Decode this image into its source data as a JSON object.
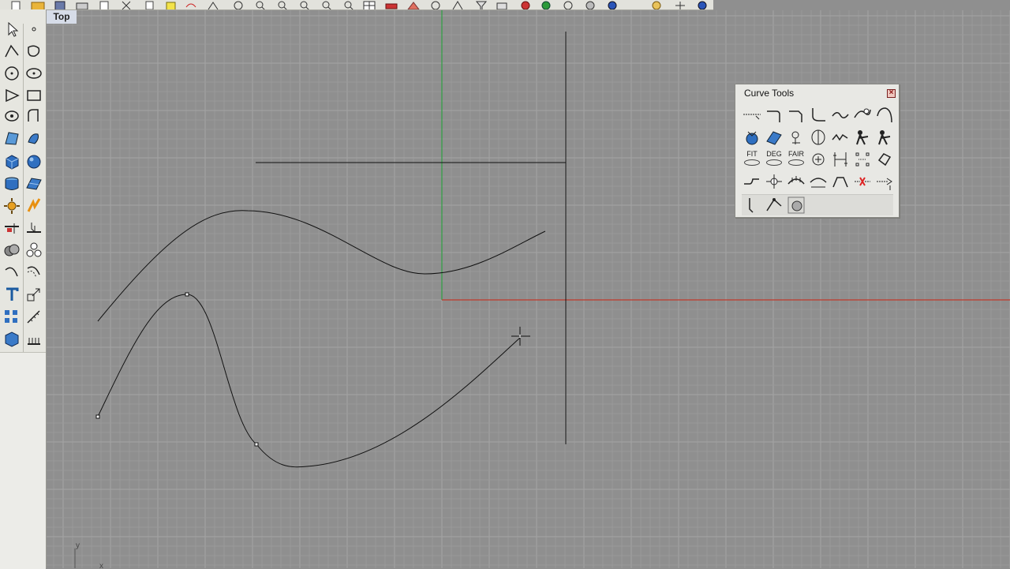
{
  "viewport": {
    "title": "Top",
    "axis_y_label": "y",
    "axis_x_label": "x"
  },
  "panel": {
    "title": "Curve Tools",
    "close_glyph": "×",
    "fit_label": "FIT",
    "deg_label": "DEG",
    "fair_label": "FAIR"
  },
  "colors": {
    "background": "#8f8f8f",
    "grid_minor": "#9a9a9a",
    "grid_major": "#a4a4a4",
    "x_axis": "#c0392b",
    "y_axis": "#2ea043",
    "curve": "#111111"
  }
}
